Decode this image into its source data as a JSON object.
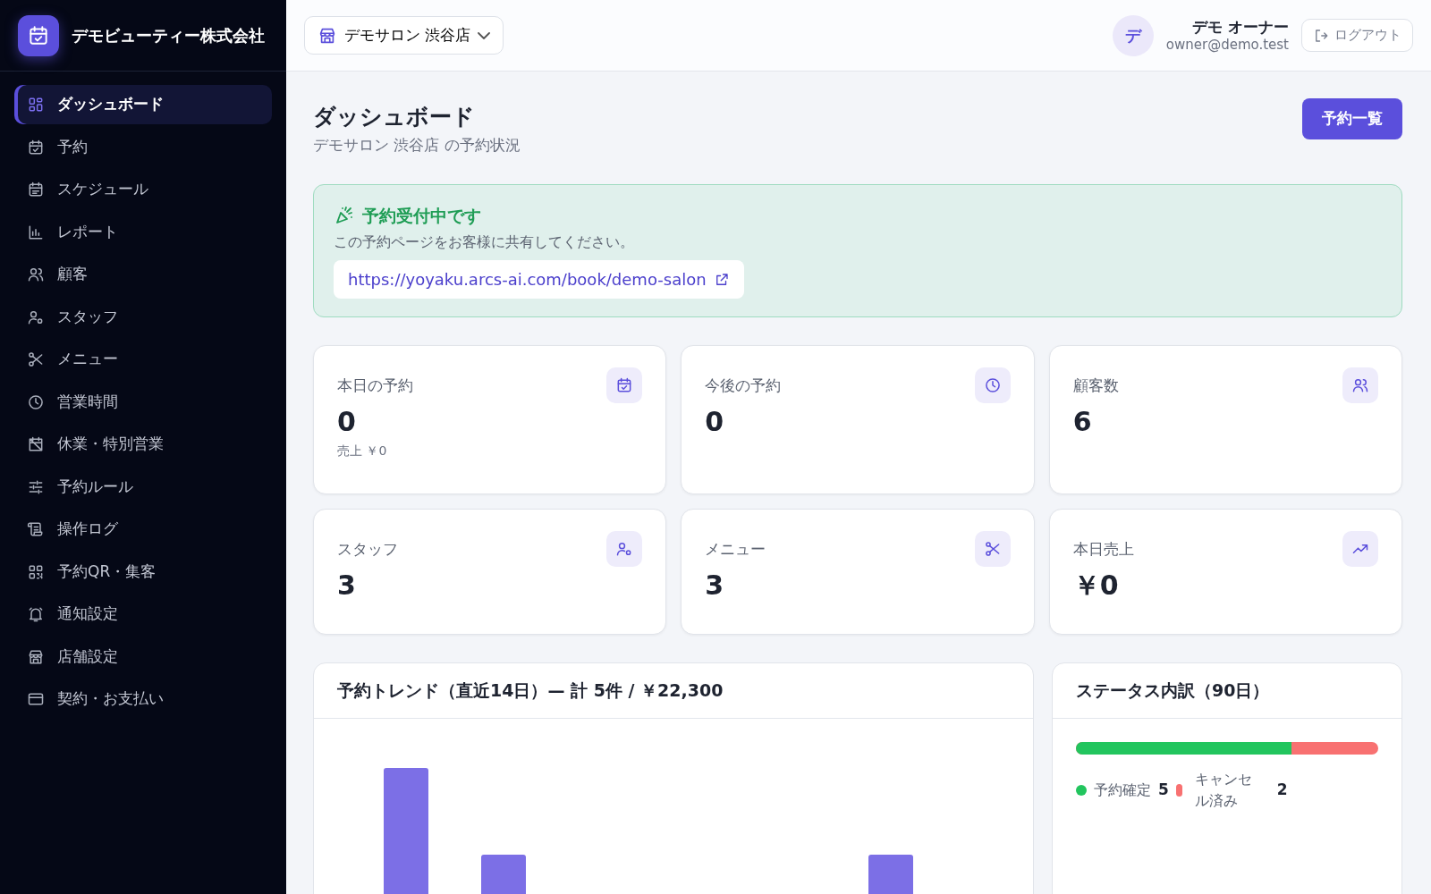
{
  "sidebar": {
    "brand": "デモビューティー株式会社",
    "items": [
      {
        "label": "ダッシュボード",
        "selected": true
      },
      {
        "label": "予約",
        "selected": false
      },
      {
        "label": "スケジュール",
        "selected": false
      },
      {
        "label": "レポート",
        "selected": false
      },
      {
        "label": "顧客",
        "selected": false
      },
      {
        "label": "スタッフ",
        "selected": false
      },
      {
        "label": "メニュー",
        "selected": false
      },
      {
        "label": "営業時間",
        "selected": false
      },
      {
        "label": "休業・特別営業",
        "selected": false
      },
      {
        "label": "予約ルール",
        "selected": false
      },
      {
        "label": "操作ログ",
        "selected": false
      },
      {
        "label": "予約QR・集客",
        "selected": false
      },
      {
        "label": "通知設定",
        "selected": false
      },
      {
        "label": "店舗設定",
        "selected": false
      },
      {
        "label": "契約・お支払い",
        "selected": false
      }
    ]
  },
  "header": {
    "store_selector": "デモサロン 渋谷店",
    "user": {
      "avatar": "デ",
      "name": "デモ オーナー",
      "email": "owner@demo.test"
    },
    "logout": "ログアウト"
  },
  "page": {
    "title": "ダッシュボード",
    "subtitle": "デモサロン 渋谷店 の予約状況",
    "action": "予約一覧"
  },
  "notice": {
    "title": "予約受付中です",
    "text": "この予約ページをお客様に共有してください。",
    "link": "https://yoyaku.arcs-ai.com/book/demo-salon"
  },
  "stats": [
    {
      "label": "本日の予約",
      "value": "0",
      "note": "売上 ￥0"
    },
    {
      "label": "今後の予約",
      "value": "0"
    },
    {
      "label": "顧客数",
      "value": "6"
    },
    {
      "label": "スタッフ",
      "value": "3"
    },
    {
      "label": "メニュー",
      "value": "3"
    },
    {
      "label": "本日売上",
      "value": "￥0"
    }
  ],
  "trend": {
    "title": "予約トレンド（直近14日）— 計 5件 / ￥22,300"
  },
  "status_breakdown": {
    "title": "ステータス内訳（90日）",
    "level": 0.714,
    "items": [
      {
        "label": "予約確定",
        "count": "5",
        "color": "#22c55e"
      },
      {
        "label": "キャンセル済み",
        "count": "2",
        "color": "#f87171"
      }
    ]
  }
}
